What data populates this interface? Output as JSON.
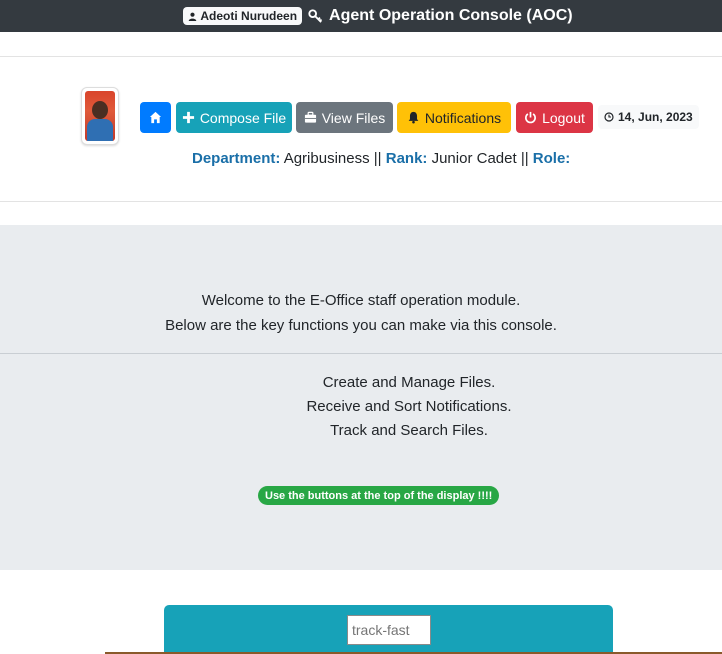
{
  "topbar": {
    "user_name": "Adeoti Nurudeen",
    "console_title": "Agent Operation Console (AOC)",
    "background": "#343a40"
  },
  "toolbar": {
    "home_icon": "home-icon",
    "compose_label": "Compose File",
    "view_label": "View Files",
    "notifications_label": "Notifications",
    "logout_label": "Logout",
    "date": "14, Jun, 2023"
  },
  "profile": {
    "department_label": "Department:",
    "department": "Agribusiness",
    "rank_label": "Rank:",
    "rank": "Junior Cadet",
    "role_label": "Role:",
    "separator": "||"
  },
  "welcome": {
    "line1": "Welcome to the E-Office staff operation module.",
    "line2": "Below are the key functions you can make via this console.",
    "functions": [
      "Create and Manage Files.",
      "Receive and Sort Notifications.",
      "Track and Search Files."
    ],
    "hint": "Use the buttons at the top of the display !!!!"
  },
  "track": {
    "placeholder": "track-fast"
  },
  "colors": {
    "primary": "#007bff",
    "info": "#17a2b8",
    "secondary": "#6c757d",
    "warning": "#ffc107",
    "danger": "#dc3545",
    "success": "#28a745",
    "label_blue": "#1a6fa8"
  }
}
